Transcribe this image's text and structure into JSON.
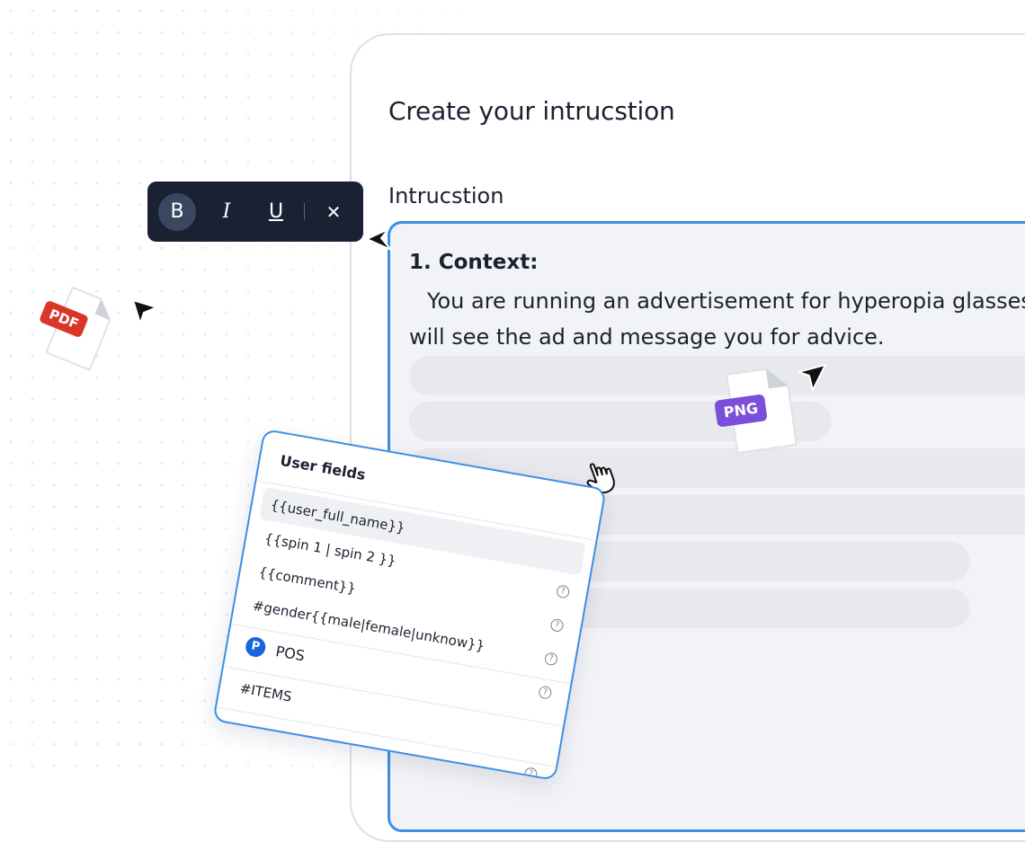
{
  "card": {
    "title": "Create your intrucstion",
    "field_label": "Intrucstion",
    "context_title": "1. Context:",
    "context_line1": "You are running an advertisement for hyperopia glasses",
    "context_line2": "will see the ad and message you for advice."
  },
  "toolbar": {
    "bold": "B",
    "italic": "I",
    "underline": "U",
    "close": "✕"
  },
  "files": {
    "pdf_badge": "PDF",
    "png_badge": "PNG"
  },
  "popup": {
    "title": "User fields",
    "items": [
      "{{user_full_name}}",
      "{{spin 1 | spin 2 }}",
      "{{comment}}",
      "#gender{{male|female|unknow}}"
    ],
    "pos_label": "POS",
    "items_label": "#ITEMS",
    "help_symbol": "?"
  },
  "colors": {
    "accent": "#3d8fe2",
    "toolbar_bg": "#192133",
    "pdf_badge": "#d9362a",
    "png_badge": "#7b4fd9",
    "pos_icon": "#1766e0"
  },
  "icons": {
    "cursor": "arrow-cursor-icon",
    "hand": "hand-pointer-icon",
    "help": "help-circle-icon",
    "pos": "pos-logo-icon"
  }
}
